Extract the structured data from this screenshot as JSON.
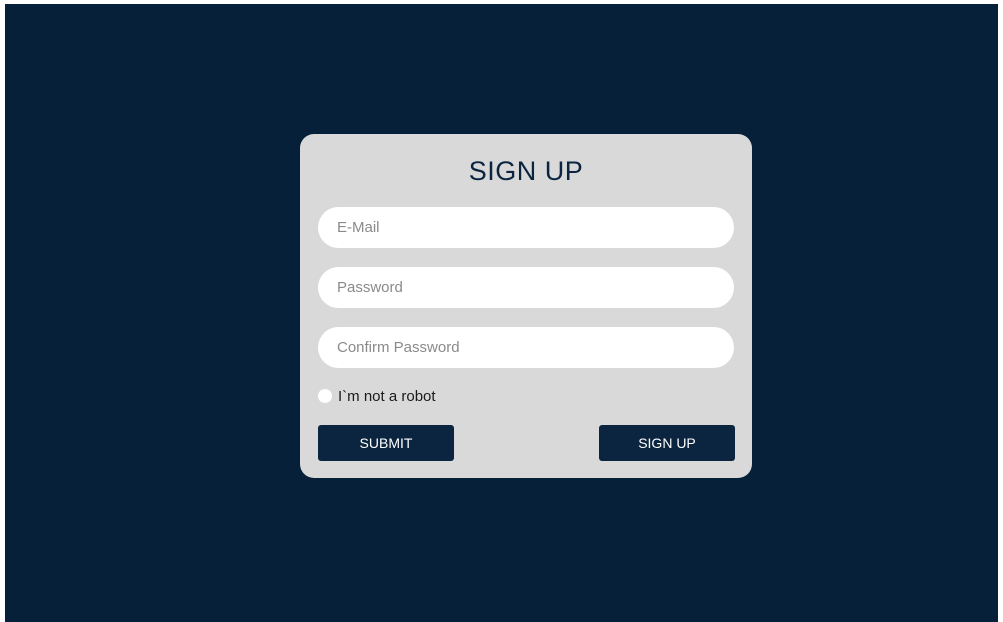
{
  "form": {
    "title": "SIGN UP",
    "email": {
      "value": "",
      "placeholder": "E-Mail"
    },
    "password": {
      "value": "",
      "placeholder": "Password"
    },
    "confirm_password": {
      "value": "",
      "placeholder": "Confirm Password"
    },
    "robot_check": {
      "label": "I`m not a robot",
      "checked": false
    },
    "submit_label": "SUBMIT",
    "signup_label": "SIGN UP"
  },
  "colors": {
    "background": "#062039",
    "card": "#d9d9d9",
    "button": "#0b2540",
    "title": "#0b2540"
  }
}
